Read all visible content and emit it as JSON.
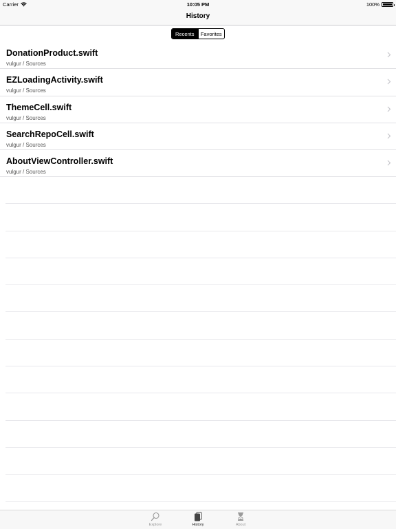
{
  "status_bar": {
    "carrier": "Carrier",
    "time": "10:05 PM",
    "battery": "100%",
    "battery_level": 1.0
  },
  "nav": {
    "title": "History"
  },
  "segmented": {
    "options": [
      "Recents",
      "Favorites"
    ],
    "selected": "Recents"
  },
  "list": {
    "items": [
      {
        "title": "DonationProduct.swift",
        "subtitle": "vulgur / Sources"
      },
      {
        "title": "EZLoadingActivity.swift",
        "subtitle": "vulgur / Sources"
      },
      {
        "title": "ThemeCell.swift",
        "subtitle": "vulgur / Sources"
      },
      {
        "title": "SearchRepoCell.swift",
        "subtitle": "vulgur / Sources"
      },
      {
        "title": "AboutViewController.swift",
        "subtitle": "vulgur / Sources"
      }
    ]
  },
  "tab_bar": {
    "tabs": [
      {
        "label": "Explore",
        "icon": "magnifier-icon"
      },
      {
        "label": "History",
        "icon": "documents-icon"
      },
      {
        "label": "About",
        "icon": "hourglass-icon"
      }
    ],
    "selected": "History"
  },
  "colors": {
    "accent": "#000000",
    "separator": "#e0e0e4",
    "bar_background": "#f8f8f8",
    "tab_inactive": "#9a9a9a"
  }
}
